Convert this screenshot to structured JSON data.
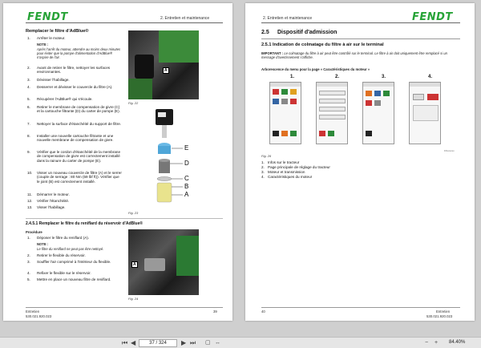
{
  "left_page": {
    "header_right": "2. Entretien et maintenance",
    "logo": "FENDT",
    "section_title": "Remplacer le filtre d'AdBlue®",
    "steps": [
      {
        "n": "1.",
        "text": "Arrêter le moteur."
      },
      {
        "n": "2.",
        "text": "Avant de retirer le filtre, nettoyer les surfaces environnantes."
      },
      {
        "n": "3.",
        "text": "Dévisser l'habillage."
      },
      {
        "n": "4.",
        "text": "Desserrer et dévisser le couvercle du filtre (A)."
      },
      {
        "n": "5.",
        "text": "Récupérer l'AdBlue® qui s'écoule."
      },
      {
        "n": "6.",
        "text": "Retirer le membrane de compensation de givre (C) et la cartouche filtrante (D) du carter de pompe (E)."
      },
      {
        "n": "7.",
        "text": "Nettoyer la surface d'étanchéité du support de filtre."
      },
      {
        "n": "8.",
        "text": "Installer une nouvelle cartouche filtrante et une nouvelle membrane de compensation de givre."
      },
      {
        "n": "9.",
        "text": "Vérifier que le cordon d'étanchéité de la membrane de compensation de givre est correctement installé dans la rainure du carter de pompe (E)."
      },
      {
        "n": "10.",
        "text": "Visser un nouveau couvercle de filtre (A) et le serrer (couple de serrage : 80 Nm (59 lbf ft)). Vérifier que le joint (B) est correctement installé."
      },
      {
        "n": "11.",
        "text": "Démarrer le moteur."
      },
      {
        "n": "12.",
        "text": "Vérifier l'étanchéité."
      },
      {
        "n": "13.",
        "text": "Visser l'habillage."
      }
    ],
    "note_label": "NOTE :",
    "note_text": "Après l'arrêt du moteur, attendre au moins deux minutes pour éviter que la pompe d'alimentation d'AdBlue® n'aspire de l'air.",
    "fig22": "Fig. 22",
    "fig23": "Fig. 23",
    "photo1_label": "A",
    "filter_labels": [
      "E",
      "D",
      "C",
      "B",
      "A"
    ],
    "section2_title": "2.4.5.1  Remplacer le filtre du reniflard du réservoir d'AdBlue®",
    "procedure": "Procédure",
    "steps2": [
      {
        "n": "1.",
        "text": "Déposer le filtre du reniflard (A)."
      },
      {
        "n": "2.",
        "text": "Retirer le flexible du réservoir."
      },
      {
        "n": "3.",
        "text": "Souffler l'air comprimé à l'intérieur du flexible."
      },
      {
        "n": "4.",
        "text": "Refixer le flexible sur le réservoir."
      },
      {
        "n": "5.",
        "text": "Mettre en place un nouveau filtre de reniflard."
      }
    ],
    "note2_label": "NOTE :",
    "note2_text": "Le filtre du reniflard ne peut pas être nettoyé.",
    "fig24": "Fig. 24",
    "photo2_label": "A",
    "footer_title": "Entretien",
    "footer_code": "530.021.920.023",
    "page_number": "39"
  },
  "right_page": {
    "header_left": "2. Entretien et maintenance",
    "logo": "FENDT",
    "section_num": "2.5",
    "section_title": "Dispositif d'admission",
    "subsection": "2.5.1  Indication de colmatage du filtre à air sur le terminal",
    "important_label": "IMPORTANT :",
    "important_text": "Le colmatage du filtre à air peut être contrôlé sur le terminal. Le filtre à air doit uniquement être remplacé si un message d'avertissement s'affiche.",
    "menu_title": "Arborescence du menu pour la page « Caractéristiques du moteur »",
    "shots": [
      "1.",
      "2.",
      "3.",
      "4."
    ],
    "fig_code": "FFxxxxxx",
    "fig26": "Fig. 26",
    "list": [
      {
        "n": "1.",
        "text": "Infos sur le tracteur"
      },
      {
        "n": "2.",
        "text": "Page principale de réglage du tracteur"
      },
      {
        "n": "3.",
        "text": "Moteur et transmission"
      },
      {
        "n": "4.",
        "text": "Caractéristiques du moteur"
      }
    ],
    "footer_title": "Entretien",
    "footer_code": "530.021.920.023",
    "page_number": "40"
  },
  "toolbar": {
    "page_indicator": "37 / 324",
    "zoom": "84.40%",
    "first_icon": "first-page-icon",
    "prev_icon": "prev-page-icon",
    "next_icon": "next-page-icon",
    "last_icon": "last-page-icon"
  },
  "colors": {
    "brand_green": "#27a337",
    "toolbar": "#e6e6e6"
  }
}
